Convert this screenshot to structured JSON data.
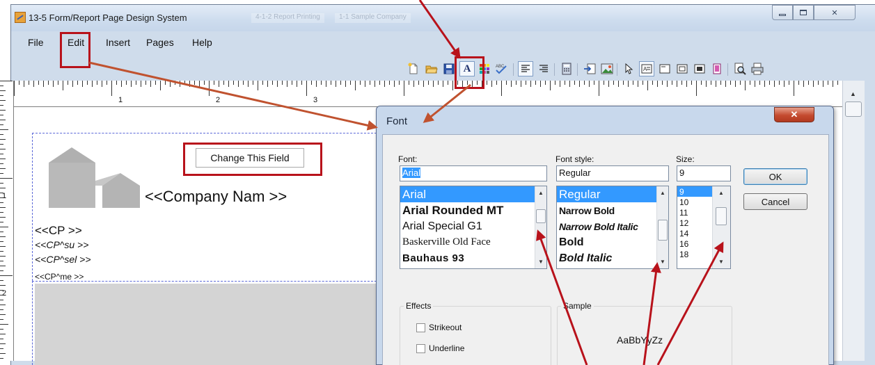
{
  "window": {
    "title": "13-5  Form/Report Page Design System",
    "background_tabs": [
      "4-1-2 Report Printing",
      "1-1 Sample Company"
    ]
  },
  "menu": {
    "items": [
      "File",
      "Edit",
      "Insert",
      "Pages",
      "Help"
    ]
  },
  "toolbar": {
    "icons": [
      "new-document-icon",
      "open-folder-icon",
      "save-icon",
      "font-icon",
      "color-palette-icon",
      "spell-check-icon",
      "align-left-icon",
      "align-right-icon",
      "calculator-icon",
      "import-icon",
      "picture-icon",
      "pointer-icon",
      "text-box-icon",
      "frame-icon",
      "frame-inner-icon",
      "frame-bottom-icon",
      "page-icon",
      "print-preview-icon",
      "print-icon"
    ],
    "font_glyph": "A"
  },
  "ruler": {
    "h_numbers": [
      "1",
      "2",
      "3"
    ],
    "v_numbers": [
      "1",
      "2"
    ]
  },
  "design": {
    "field_label": "Change This Field",
    "company_name": "<<Company Nam >>",
    "cp_fields": [
      "<<CP  >>",
      "<<CP^su  >>",
      "<<CP^sel  >>",
      "<<CP^me  >>"
    ]
  },
  "font_dialog": {
    "title": "Font",
    "font_label": "Font:",
    "font_value": "Arial",
    "fonts": [
      "Arial",
      "Arial Rounded MT",
      "Arial Special G1",
      "Baskerville Old Face",
      "Bauhaus 93"
    ],
    "style_label": "Font style:",
    "style_value": "Regular",
    "styles": [
      "Regular",
      "Narrow Bold",
      "Narrow Bold Italic",
      "Bold",
      "Bold Italic"
    ],
    "size_label": "Size:",
    "size_value": "9",
    "sizes": [
      "9",
      "10",
      "11",
      "12",
      "14",
      "16",
      "18"
    ],
    "ok_label": "OK",
    "cancel_label": "Cancel",
    "effects_label": "Effects",
    "strikeout_label": "Strikeout",
    "underline_label": "Underline",
    "sample_label": "Sample",
    "sample_text": "AaBbYyZz"
  },
  "colors": {
    "annotation_red": "#b8121b",
    "arrow_brown": "#c0522f",
    "selection_blue": "#3399ff"
  }
}
